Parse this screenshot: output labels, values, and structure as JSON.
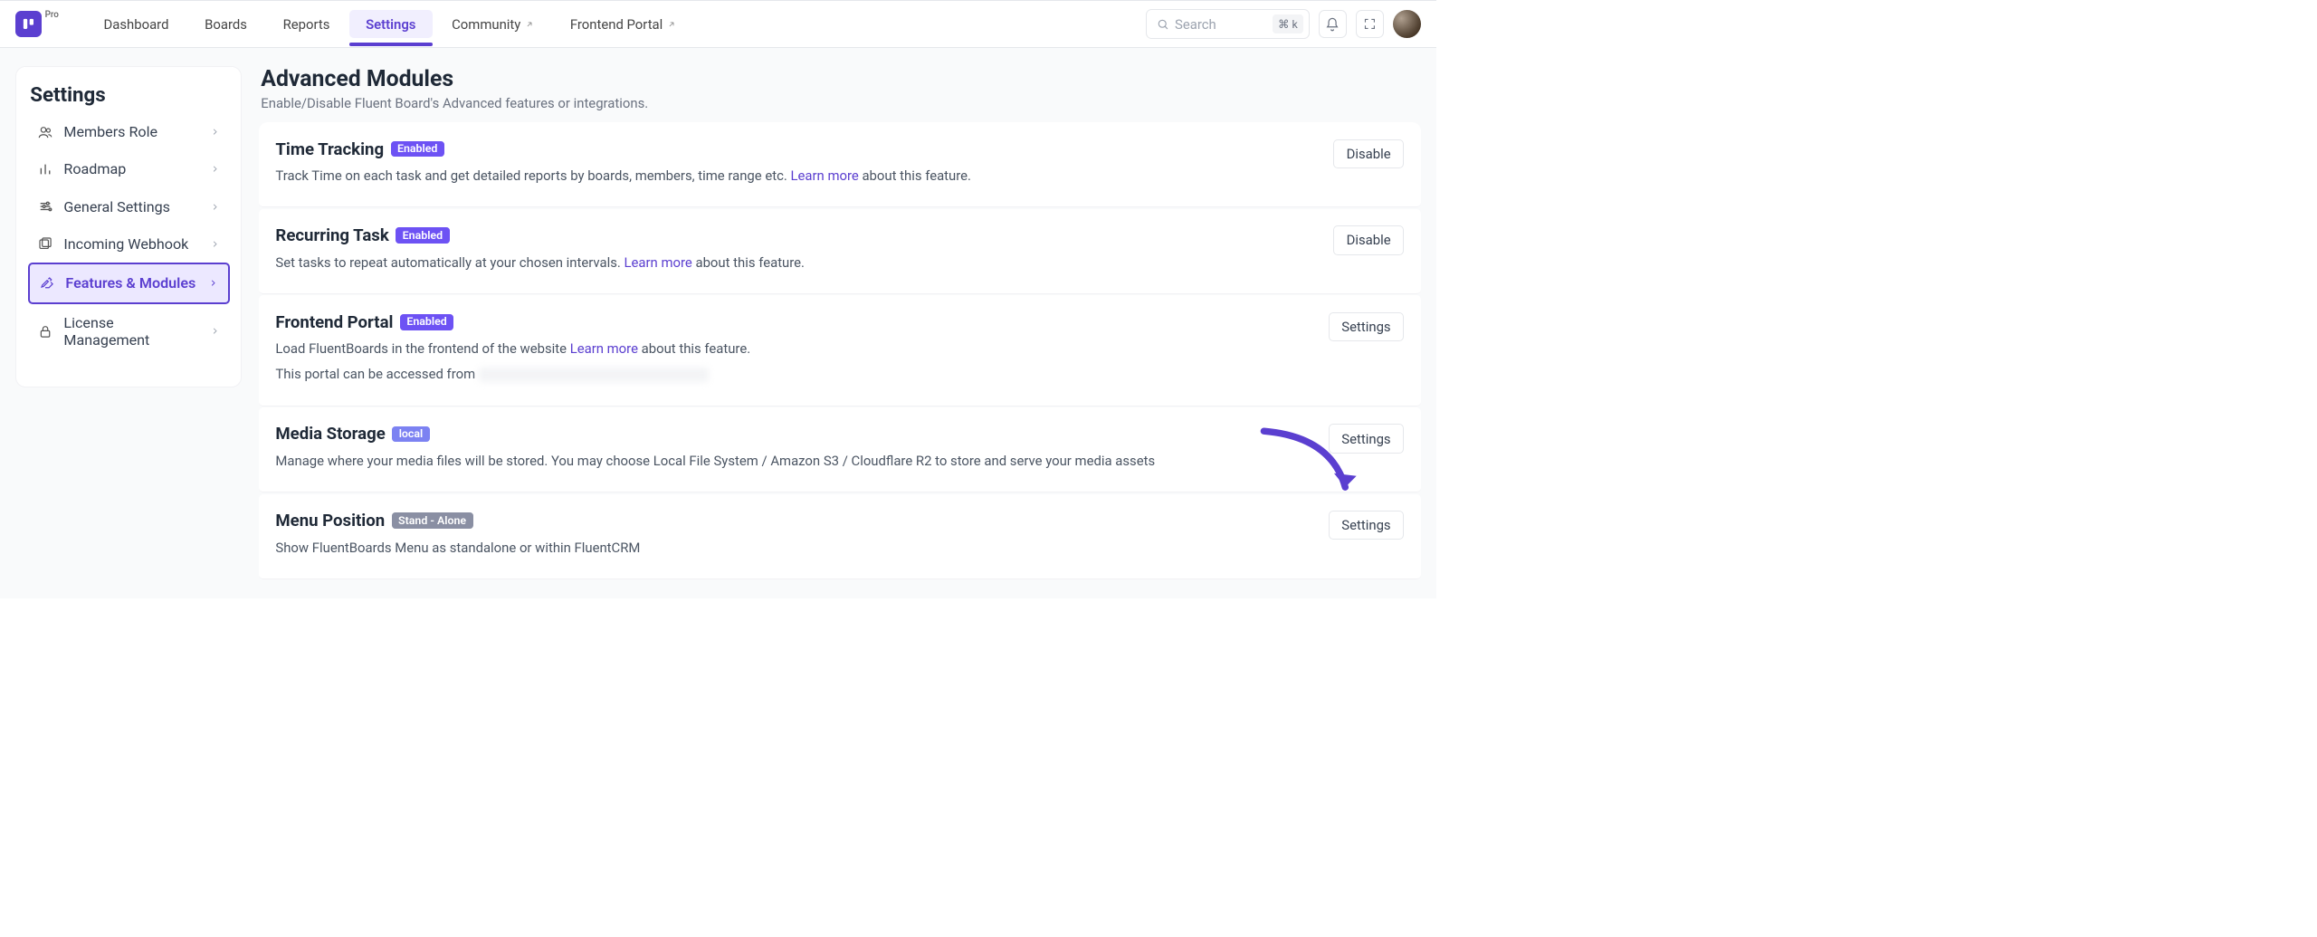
{
  "app": {
    "plan": "Pro"
  },
  "nav": {
    "items": [
      {
        "label": "Dashboard",
        "external": false
      },
      {
        "label": "Boards",
        "external": false
      },
      {
        "label": "Reports",
        "external": false
      },
      {
        "label": "Settings",
        "external": false
      },
      {
        "label": "Community",
        "external": true
      },
      {
        "label": "Frontend Portal",
        "external": true
      }
    ],
    "activeIndex": 3
  },
  "search": {
    "placeholder": "Search",
    "shortcut": "⌘ k"
  },
  "sidebar": {
    "title": "Settings",
    "items": [
      {
        "label": "Members Role",
        "icon": "users"
      },
      {
        "label": "Roadmap",
        "icon": "chart"
      },
      {
        "label": "General Settings",
        "icon": "sliders"
      },
      {
        "label": "Incoming Webhook",
        "icon": "copy"
      },
      {
        "label": "Features & Modules",
        "icon": "tool"
      },
      {
        "label": "License Management",
        "icon": "lock"
      }
    ],
    "activeIndex": 4
  },
  "page": {
    "title": "Advanced Modules",
    "subtitle": "Enable/Disable Fluent Board's Advanced features or integrations."
  },
  "modules": [
    {
      "title": "Time Tracking",
      "badge": "Enabled",
      "badgeClass": "enabled",
      "descPre": "Track Time on each task and get detailed reports by boards, members, time range etc. ",
      "learnMore": "Learn more",
      "descPost": " about this feature.",
      "action": "Disable"
    },
    {
      "title": "Recurring Task",
      "badge": "Enabled",
      "badgeClass": "enabled",
      "descPre": "Set tasks to repeat automatically at your chosen intervals. ",
      "learnMore": "Learn more",
      "descPost": " about this feature.",
      "action": "Disable"
    },
    {
      "title": "Frontend Portal",
      "badge": "Enabled",
      "badgeClass": "enabled",
      "descPre": "Load FluentBoards in the frontend of the website ",
      "learnMore": "Learn more",
      "descPost": " about this feature.",
      "extraLine": "This portal can be accessed from ",
      "blurred": true,
      "action": "Settings"
    },
    {
      "title": "Media Storage",
      "badge": "local",
      "badgeClass": "local",
      "descPre": "Manage where your media files will be stored. You may choose Local File System / Amazon S3 / Cloudflare R2 to store and serve your media assets",
      "learnMore": "",
      "descPost": "",
      "action": "Settings"
    },
    {
      "title": "Menu Position",
      "badge": "Stand - Alone",
      "badgeClass": "neutral",
      "descPre": "Show FluentBoards Menu as standalone or within FluentCRM",
      "learnMore": "",
      "descPost": "",
      "action": "Settings"
    }
  ]
}
